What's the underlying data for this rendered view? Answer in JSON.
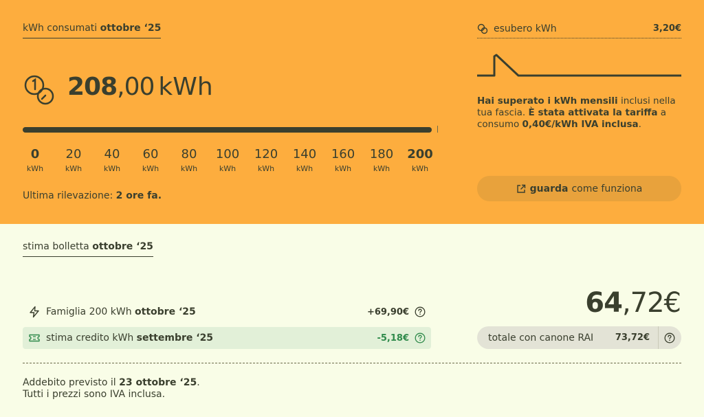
{
  "consumption": {
    "tab_prefix": "kWh consumati",
    "tab_period": "ottobre ‘25",
    "value_int": "208",
    "value_dec": ",00",
    "unit": "kWh",
    "progress_fraction": 1.0,
    "scale": [
      {
        "num": "0",
        "unit": "kWh",
        "bold": true
      },
      {
        "num": "20",
        "unit": "kWh"
      },
      {
        "num": "40",
        "unit": "kWh"
      },
      {
        "num": "60",
        "unit": "kWh"
      },
      {
        "num": "80",
        "unit": "kWh"
      },
      {
        "num": "100",
        "unit": "kWh"
      },
      {
        "num": "120",
        "unit": "kWh"
      },
      {
        "num": "140",
        "unit": "kWh"
      },
      {
        "num": "160",
        "unit": "kWh"
      },
      {
        "num": "180",
        "unit": "kWh"
      },
      {
        "num": "200",
        "unit": "kWh",
        "bold": true
      }
    ],
    "last_read_label": "Ultima rilevazione:",
    "last_read_value": "2 ore fa."
  },
  "surplus": {
    "label": "esubero kWh",
    "value": "3,20€",
    "icon": "coins-icon"
  },
  "notice": {
    "bold1": "Hai superato i kWh mensili",
    "text1": " inclusi nella tua fascia. ",
    "bold2": "È stata attivata la tariffa",
    "text2": " a consumo ",
    "bold3": "0,40€/kWh IVA inclusa",
    "text3": "."
  },
  "howto_button": {
    "bold": "guarda",
    "label": "come funziona",
    "icon": "external-link-icon"
  },
  "bill": {
    "tab_prefix": "stima bolletta",
    "tab_period": "ottobre ‘25",
    "lines": [
      {
        "label": "Famiglia 200 kWh",
        "period": "ottobre ‘25",
        "amount": "+69,90€",
        "icon": "lightning-icon"
      },
      {
        "label": "stima credito kWh",
        "period": "settembre ‘25",
        "amount": "-5,18€",
        "icon": "ticket-icon"
      }
    ],
    "total_int": "64",
    "total_dec": ",72€",
    "rai_label": "totale con canone RAI",
    "rai_value": "73,72€",
    "footer_prefix": "Addebito previsto il ",
    "footer_date": "23 ottobre ‘25",
    "footer_suffix": ".",
    "footer_line2": "Tutti i prezzi sono IVA inclusa."
  },
  "colors": {
    "top_bg": "#fdad3e",
    "bottom_bg": "#f9fde7",
    "text": "#3a3f2e",
    "credit_green": "#2f8a4b",
    "credit_bg": "#e2f0d8"
  }
}
